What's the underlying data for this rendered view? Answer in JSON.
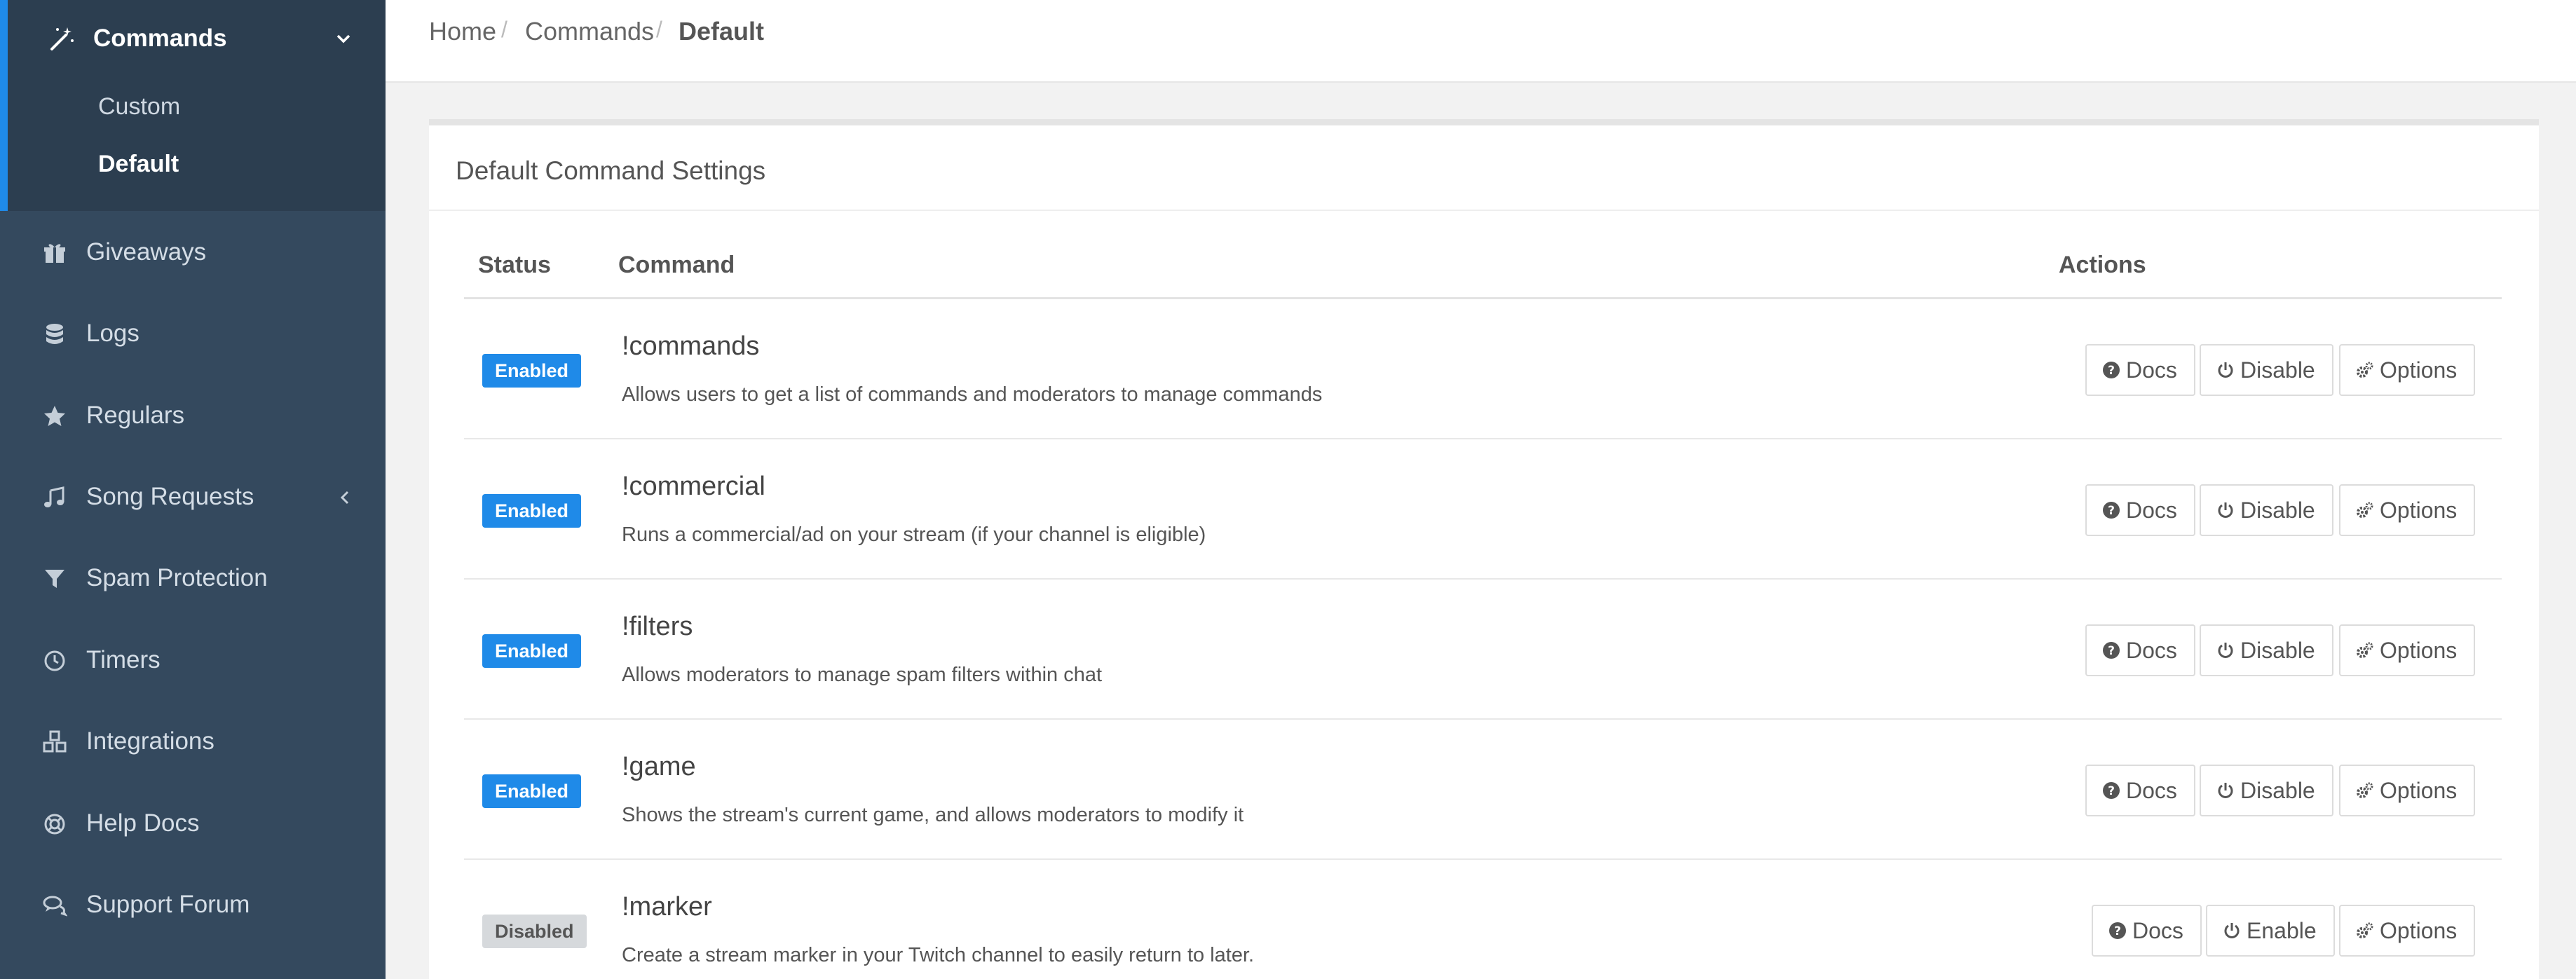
{
  "sidebar": {
    "active_section": {
      "label": "Commands",
      "icon": "magic-wand-icon",
      "subitems": [
        {
          "label": "Custom",
          "active": false
        },
        {
          "label": "Default",
          "active": true
        }
      ]
    },
    "items": [
      {
        "label": "Giveaways",
        "icon": "gift-icon"
      },
      {
        "label": "Logs",
        "icon": "database-icon"
      },
      {
        "label": "Regulars",
        "icon": "star-icon"
      },
      {
        "label": "Song Requests",
        "icon": "music-icon"
      },
      {
        "label": "Spam Protection",
        "icon": "filter-icon"
      },
      {
        "label": "Timers",
        "icon": "clock-icon"
      },
      {
        "label": "Integrations",
        "icon": "cubes-icon"
      },
      {
        "label": "Help Docs",
        "icon": "life-ring-icon"
      },
      {
        "label": "Support Forum",
        "icon": "comments-icon"
      }
    ]
  },
  "breadcrumb": {
    "items": [
      "Home",
      "Commands"
    ],
    "current": "Default",
    "separator": "/"
  },
  "panel": {
    "title": "Default Command Settings",
    "columns": {
      "status": "Status",
      "command": "Command",
      "actions": "Actions"
    },
    "rows": [
      {
        "status": "Enabled",
        "name": "!commands",
        "description": "Allows users to get a list of commands and moderators to manage commands",
        "actions": [
          "Docs",
          "Disable",
          "Options"
        ]
      },
      {
        "status": "Enabled",
        "name": "!commercial",
        "description": "Runs a commercial/ad on your stream (if your channel is eligible)",
        "actions": [
          "Docs",
          "Disable",
          "Options"
        ]
      },
      {
        "status": "Enabled",
        "name": "!filters",
        "description": "Allows moderators to manage spam filters within chat",
        "actions": [
          "Docs",
          "Disable",
          "Options"
        ]
      },
      {
        "status": "Enabled",
        "name": "!game",
        "description": "Shows the stream's current game, and allows moderators to modify it",
        "actions": [
          "Docs",
          "Disable",
          "Options"
        ]
      },
      {
        "status": "Disabled",
        "name": "!marker",
        "description": "Create a stream marker in your Twitch channel to easily return to later.",
        "actions": [
          "Docs",
          "Enable",
          "Options"
        ]
      }
    ]
  },
  "colors": {
    "accent": "#1f8ae8",
    "sidebar": "#34495e",
    "sidebar_active": "#2c3e50",
    "disabled_badge": "#d6d9dc"
  }
}
